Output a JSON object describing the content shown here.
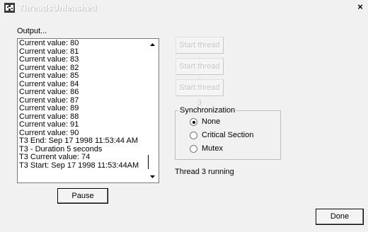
{
  "window": {
    "title": "ThreadsUnleashed",
    "close_glyph": "×",
    "icon": "app-threads-icon"
  },
  "output": {
    "label": "Output...",
    "lines": [
      "Current value: 80",
      "Current value: 81",
      "Current value: 83",
      "Current value: 82",
      "Current value: 85",
      "Current value: 84",
      "Current value: 86",
      "Current value: 87",
      "Current value: 89",
      "Current value: 88",
      "Current value: 91",
      "Current value: 90",
      "T3  End: Sep 17 1998 11:53:44 AM",
      "T3 - Duration 5 seconds",
      "T3 Current value: 74",
      "T3 Start: Sep 17 1998 11:53:44AM"
    ]
  },
  "buttons": {
    "start1": "Start thread 1",
    "start2": "Start thread 2",
    "start3": "Start thread 3",
    "pause": "Pause",
    "done": "Done"
  },
  "sync": {
    "legend": "Synchronization",
    "options": [
      "None",
      "Critical Section",
      "Mutex"
    ],
    "selected": "None"
  },
  "status": "Thread 3 running"
}
